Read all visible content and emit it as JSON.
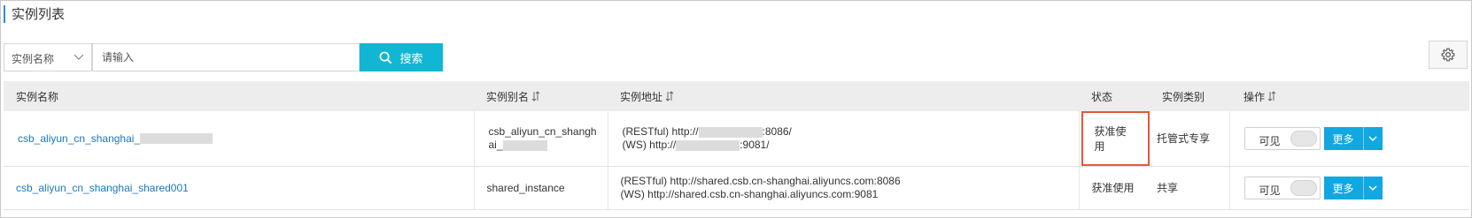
{
  "page": {
    "title": "实例列表",
    "accent_color": "#2b8ce6"
  },
  "search": {
    "field_selected": "实例名称",
    "placeholder": "请输入",
    "button_label": "搜索",
    "button_color": "#11b6d4"
  },
  "table": {
    "columns": [
      {
        "label": "实例名称",
        "sortable": false
      },
      {
        "label": "实例别名",
        "sortable": true
      },
      {
        "label": "实例地址",
        "sortable": true
      },
      {
        "label": "状态",
        "sortable": false
      },
      {
        "label": "实例类别",
        "sortable": false
      },
      {
        "label": "操作",
        "sortable": true
      }
    ],
    "rows": [
      {
        "name": "csb_aliyun_cn_shanghai_",
        "alias_line1": "csb_aliyun_cn_shangh",
        "alias_line2": "ai_",
        "address_restful_prefix": "(RESTful) http://",
        "address_restful_suffix": ":8086/",
        "address_ws_prefix": "(WS) http://",
        "address_ws_suffix": ":9081/",
        "status": "获准使用",
        "category": "托管式专享",
        "visible_label": "可见",
        "more_label": "更多"
      },
      {
        "name": "csb_aliyun_cn_shanghai_shared001",
        "alias": "shared_instance",
        "address_restful": "(RESTful) http://shared.csb.cn-shanghai.aliyuncs.com:8086",
        "address_ws": "(WS) http://shared.csb.cn-shanghai.aliyuncs.com:9081",
        "status": "获准使用",
        "category": "共享",
        "visible_label": "可见",
        "more_label": "更多"
      }
    ]
  },
  "colors": {
    "link": "#1c77c3",
    "primary_button": "#11a8e2",
    "highlight_border": "#e5583a"
  }
}
